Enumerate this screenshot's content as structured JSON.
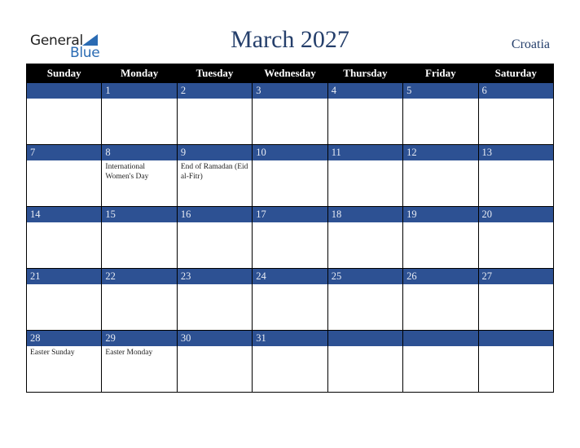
{
  "logo": {
    "line1": "General",
    "line2": "Blue"
  },
  "header": {
    "title": "March 2027",
    "country": "Croatia"
  },
  "colors": {
    "day_bar": "#2d5193",
    "header_bg": "#000000",
    "title": "#253f6b",
    "logo_blue": "#2a6bb3"
  },
  "weekdays": [
    "Sunday",
    "Monday",
    "Tuesday",
    "Wednesday",
    "Thursday",
    "Friday",
    "Saturday"
  ],
  "weeks": [
    [
      {
        "day": "",
        "event": ""
      },
      {
        "day": "1",
        "event": ""
      },
      {
        "day": "2",
        "event": ""
      },
      {
        "day": "3",
        "event": ""
      },
      {
        "day": "4",
        "event": ""
      },
      {
        "day": "5",
        "event": ""
      },
      {
        "day": "6",
        "event": ""
      }
    ],
    [
      {
        "day": "7",
        "event": ""
      },
      {
        "day": "8",
        "event": "International Women's Day"
      },
      {
        "day": "9",
        "event": "End of Ramadan (Eid al-Fitr)"
      },
      {
        "day": "10",
        "event": ""
      },
      {
        "day": "11",
        "event": ""
      },
      {
        "day": "12",
        "event": ""
      },
      {
        "day": "13",
        "event": ""
      }
    ],
    [
      {
        "day": "14",
        "event": ""
      },
      {
        "day": "15",
        "event": ""
      },
      {
        "day": "16",
        "event": ""
      },
      {
        "day": "17",
        "event": ""
      },
      {
        "day": "18",
        "event": ""
      },
      {
        "day": "19",
        "event": ""
      },
      {
        "day": "20",
        "event": ""
      }
    ],
    [
      {
        "day": "21",
        "event": ""
      },
      {
        "day": "22",
        "event": ""
      },
      {
        "day": "23",
        "event": ""
      },
      {
        "day": "24",
        "event": ""
      },
      {
        "day": "25",
        "event": ""
      },
      {
        "day": "26",
        "event": ""
      },
      {
        "day": "27",
        "event": ""
      }
    ],
    [
      {
        "day": "28",
        "event": "Easter Sunday"
      },
      {
        "day": "29",
        "event": "Easter Monday"
      },
      {
        "day": "30",
        "event": ""
      },
      {
        "day": "31",
        "event": ""
      },
      {
        "day": "",
        "event": ""
      },
      {
        "day": "",
        "event": ""
      },
      {
        "day": "",
        "event": ""
      }
    ]
  ]
}
